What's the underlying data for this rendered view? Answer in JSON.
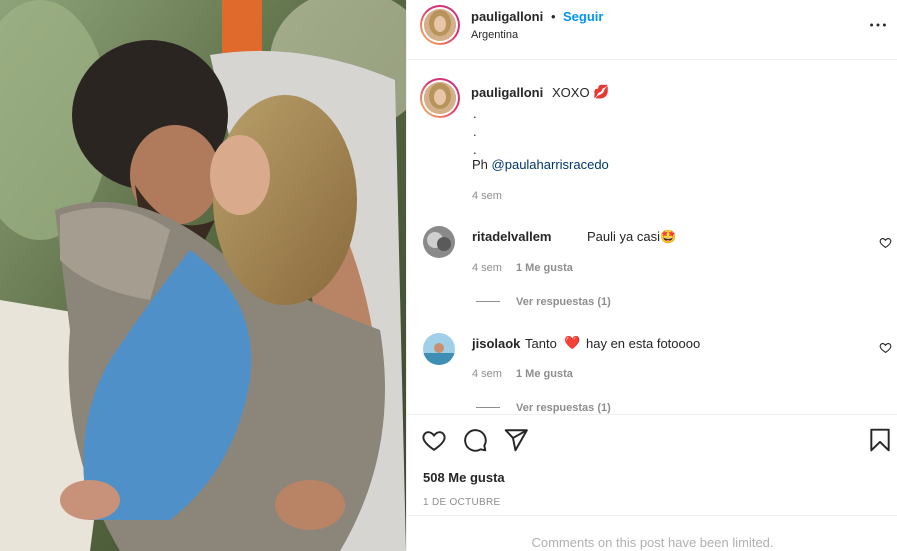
{
  "post": {
    "username": "pauligalloni",
    "separator": "•",
    "follow_label": "Seguir",
    "location": "Argentina",
    "more_icon": "more-horizontal-icon",
    "photo_icon": "post-photo"
  },
  "caption": {
    "username": "pauligalloni",
    "text": "XOXO",
    "emoji": "💋",
    "dots": [
      ".",
      ".",
      "."
    ],
    "credit_prefix": "Ph",
    "mention": "@paulaharrisracedo",
    "time": "4 sem"
  },
  "comments": [
    {
      "username": "ritadelvallem",
      "text": "Pauli ya casi🤩",
      "time": "4 sem",
      "likes": "1 Me gusta",
      "view_replies": "Ver respuestas (1)"
    },
    {
      "username": "jisolaok",
      "text_before": "Tanto",
      "emoji": "❤️",
      "text_after": "hay en esta fotoooo",
      "time": "4 sem",
      "likes": "1 Me gusta",
      "view_replies": "Ver respuestas (1)"
    }
  ],
  "actions": {
    "like_icon": "heart-icon",
    "comment_icon": "comment-icon",
    "share_icon": "share-icon",
    "save_icon": "bookmark-icon"
  },
  "likes_count": "508 Me gusta",
  "date": "1 DE OCTUBRE",
  "comments_limited": "Comments on this post have been limited.",
  "colors": {
    "link_blue": "#0095f6",
    "mention_blue": "#00376b",
    "muted_gray": "#8e8e8e",
    "text": "#262626",
    "border": "#efefef"
  }
}
